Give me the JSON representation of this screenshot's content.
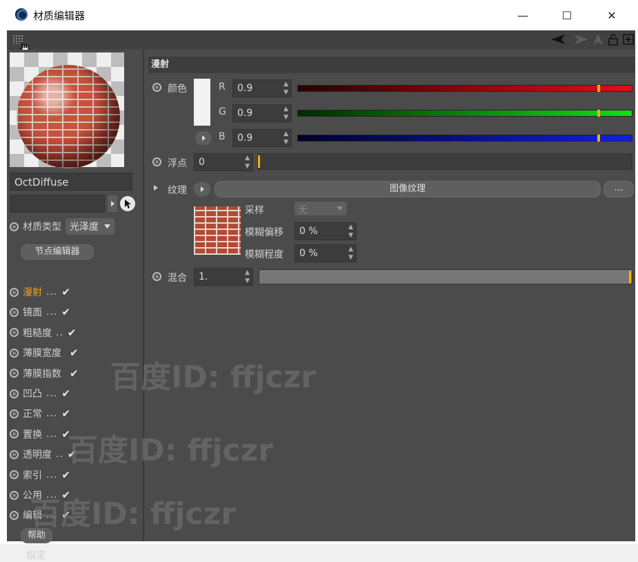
{
  "window": {
    "title": "材质编辑器",
    "minimize": "—",
    "maximize": "☐",
    "close": "✕"
  },
  "material": {
    "name": "OctDiffuse",
    "type_label": "材质类型",
    "type_value": "光泽度",
    "node_editor": "节点编辑器"
  },
  "channels": [
    {
      "label": "漫射",
      "dots": "...",
      "checked": "✔",
      "active": true
    },
    {
      "label": "镜面",
      "dots": "...",
      "checked": "✔"
    },
    {
      "label": "粗糙度",
      "dots": "..",
      "checked": "✔"
    },
    {
      "label": "薄膜宽度",
      "dots": "",
      "checked": "✔"
    },
    {
      "label": "薄膜指数",
      "dots": "",
      "checked": "✔"
    },
    {
      "label": "凹凸",
      "dots": "...",
      "checked": "✔"
    },
    {
      "label": "正常",
      "dots": "...",
      "checked": "✔"
    },
    {
      "label": "置换",
      "dots": "...",
      "checked": "✔"
    },
    {
      "label": "透明度",
      "dots": "..",
      "checked": "✔"
    },
    {
      "label": "索引",
      "dots": "...",
      "checked": "✔"
    },
    {
      "label": "公用",
      "dots": "...",
      "checked": "✔"
    },
    {
      "label": "编辑",
      "dots": "...",
      "checked": "✔"
    }
  ],
  "help_button": "帮助",
  "assign_label": "指定",
  "diffuse": {
    "section_title": "漫射",
    "color_label": "颜色",
    "r_label": "R",
    "r_value": "0.9",
    "r_fraction": 0.9,
    "g_label": "G",
    "g_value": "0.9",
    "g_fraction": 0.9,
    "b_label": "B",
    "b_value": "0.9",
    "b_fraction": 0.9,
    "float_label": "浮点",
    "float_value": "0",
    "texture_label": "纹理",
    "texture_button": "图像纹理",
    "more_button": "...",
    "sampling_label": "采样",
    "sampling_value": "无",
    "blur_offset_label": "模糊偏移",
    "blur_offset_value": "0 %",
    "blur_degree_label": "模糊程度",
    "blur_degree_value": "0 %",
    "mix_label": "混合",
    "mix_value": "1.",
    "mix_fraction": 1.0
  },
  "watermark": "百度ID: ffjczr",
  "colors": {
    "red": "#e01010",
    "green": "#10d010",
    "blue": "#1020e0",
    "marker": "#ffb000",
    "active": "#f0a020"
  }
}
